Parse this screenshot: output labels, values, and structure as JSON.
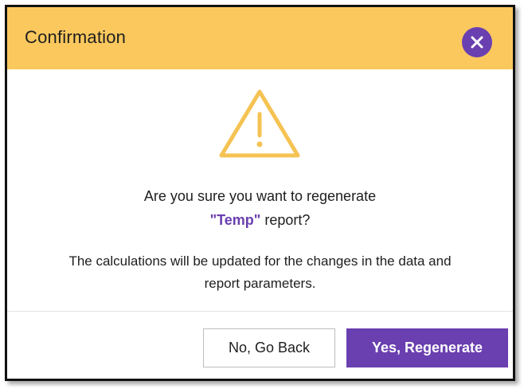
{
  "dialog": {
    "title": "Confirmation",
    "close_icon": "close-icon",
    "warning_icon": "warning-triangle-icon",
    "question_line1": "Are you sure you want to regenerate",
    "report_name": "\"Temp\"",
    "question_line2_suffix": " report?",
    "details_line1": "The calculations will be updated for the changes in the data and",
    "details_line2": "report parameters.",
    "back_label": "No, Go Back",
    "confirm_label": "Yes, Regenerate"
  },
  "colors": {
    "header_bg": "#fbc85e",
    "accent": "#6a3fb0",
    "warning": "#f5c353"
  }
}
